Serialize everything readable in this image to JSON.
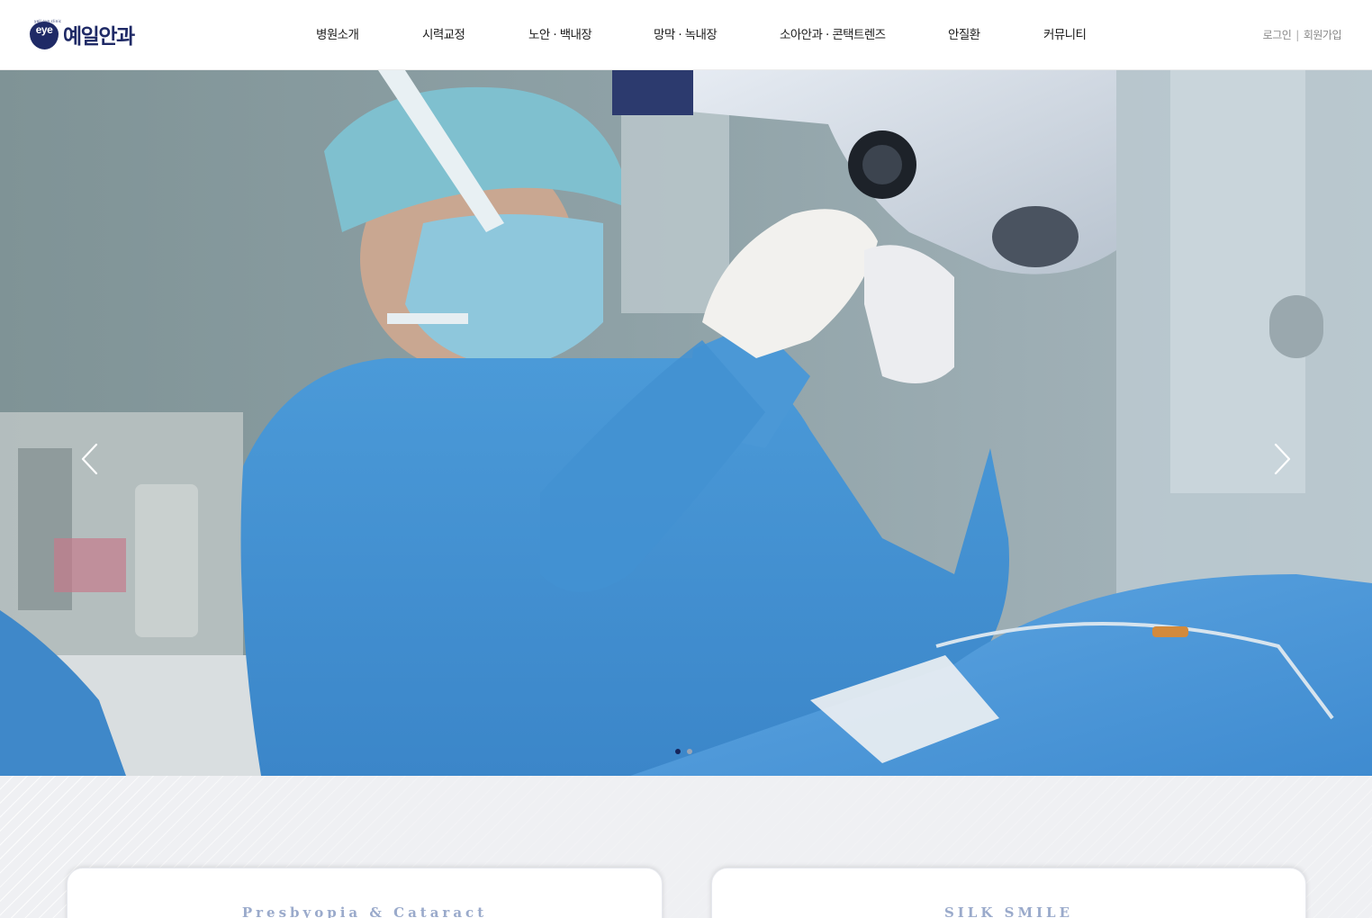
{
  "header": {
    "logo_text": "예일안과",
    "logo_mark_text": "eye",
    "logo_tagline": "yeil eye clinic",
    "brand_color": "#1f2a66"
  },
  "nav": {
    "items": [
      {
        "label": "병원소개"
      },
      {
        "label": "시력교정"
      },
      {
        "label": "노안 · 백내장"
      },
      {
        "label": "망막 · 녹내장"
      },
      {
        "label": "소아안과 · 콘택트렌즈"
      },
      {
        "label": "안질환"
      },
      {
        "label": "커뮤니티"
      }
    ]
  },
  "util": {
    "login": "로그인",
    "separator": "|",
    "signup": "회원가입"
  },
  "slider": {
    "prev_icon": "chevron-left-icon",
    "next_icon": "chevron-right-icon",
    "active_slide": 1,
    "total_slides": 2,
    "accent_color": "#16245a"
  },
  "cards": [
    {
      "title": "Presbyopia & Cataract"
    },
    {
      "title": "SILK SMILE"
    }
  ]
}
